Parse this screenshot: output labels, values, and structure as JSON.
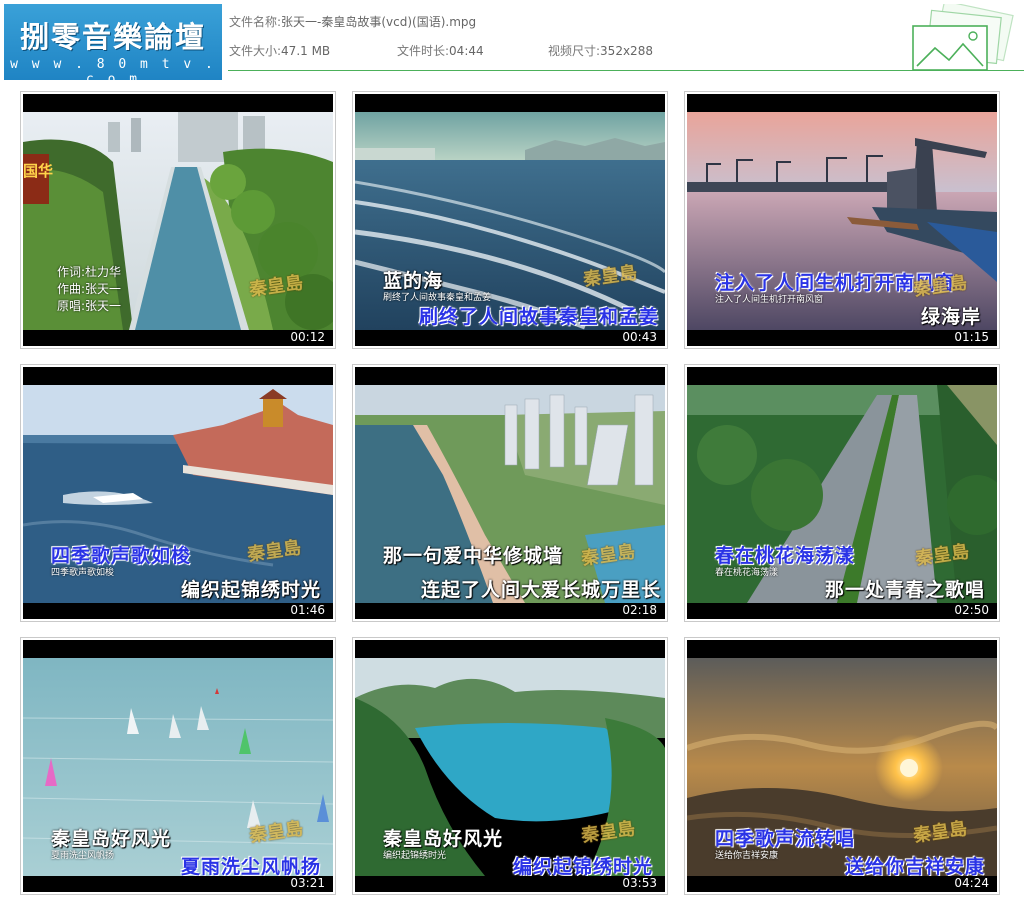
{
  "logo": {
    "title": "捌零音樂論壇",
    "url": "w w w . 8 0 m t v . c o m"
  },
  "file_info": {
    "name_label": "文件名称:",
    "name_value": "张天一-秦皇岛故事(vcd)(国语).mpg",
    "size_label": "文件大小:",
    "size_value": "47.1 MB",
    "duration_label": "文件时长:",
    "duration_value": "04:44",
    "dimensions_label": "视频尺寸:",
    "dimensions_value": "352x288"
  },
  "watermark_text": "秦皇島",
  "thumbnails": [
    {
      "timestamp": "00:12",
      "credits": [
        "作词:杜力华",
        "作曲:张天一",
        "原唱:张天一"
      ],
      "side_sign": "国华"
    },
    {
      "timestamp": "00:43",
      "line1": "蓝的海",
      "line1_sub": "刷终了人间故事秦皇和孟姜",
      "line2": "刷终了人间故事秦皇和孟姜"
    },
    {
      "timestamp": "01:15",
      "line1": "注入了人间生机打开南风窗",
      "line1_sub": "注入了人间生机打开南风窗",
      "line2": "绿海岸"
    },
    {
      "timestamp": "01:46",
      "line1": "四季歌声歌如梭",
      "line1_sub": "四季歌声歌如梭",
      "line2": "编织起锦绣时光"
    },
    {
      "timestamp": "02:18",
      "line1": "那一句爱中华修城墙",
      "line2": "连起了人间大爱长城万里长"
    },
    {
      "timestamp": "02:50",
      "line1": "春在桃花海荡漾",
      "line1_sub": "春在桃花海荡漾",
      "line2": "那一处青春之歌唱"
    },
    {
      "timestamp": "03:21",
      "line1": "秦皇岛好风光",
      "line1_sub": "夏雨洗尘风帆扬",
      "line2": "夏雨洗尘风帆扬"
    },
    {
      "timestamp": "03:53",
      "line1": "秦皇岛好风光",
      "line1_sub": "编织起锦绣时光",
      "line2": "编织起锦绣时光"
    },
    {
      "timestamp": "04:24",
      "line1": "四季歌声流转唱",
      "line1_sub": "送给你吉祥安康",
      "line2": "送给你吉祥安康"
    }
  ],
  "colors": {
    "logo_bg": "#2a92cf",
    "divider": "#4cb05a",
    "lyric_blue": "#2a33e6",
    "lyric_white": "#ffffff"
  }
}
